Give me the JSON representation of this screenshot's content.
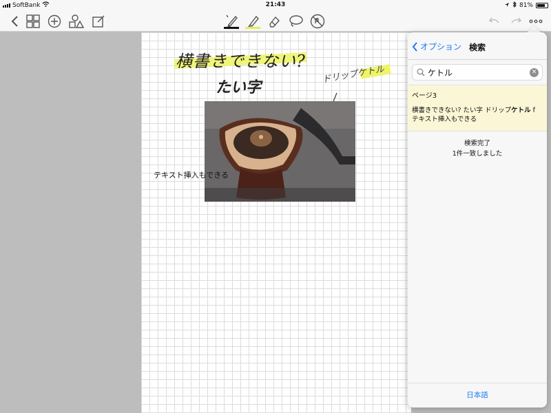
{
  "status_bar": {
    "carrier": "SoftBank",
    "time": "21:43",
    "battery": "81%",
    "battery_fraction": 0.81
  },
  "toolbar": {
    "left_icons": [
      "back-chevron-icon",
      "grid-icon",
      "add-circle-icon",
      "shapes-icon",
      "edit-icon"
    ],
    "tools": [
      {
        "name": "pen-tool",
        "underline_color": "#111111",
        "selected": true
      },
      {
        "name": "highlighter-tool",
        "underline_color": "#e8ec5a",
        "selected": false
      },
      {
        "name": "eraser-tool"
      },
      {
        "name": "lasso-tool"
      },
      {
        "name": "no-touch-tool"
      }
    ],
    "right_icons": [
      "undo-icon",
      "redo-icon",
      "more-icon"
    ]
  },
  "canvas": {
    "handwriting_title": "横書きできない?",
    "handwriting_futoi": "たい字",
    "handwriting_drip": "ドリップケトル",
    "text_insert": "テキスト挿入もできる",
    "highlight_color": "#eef46a"
  },
  "search_panel": {
    "back_label": "オプション",
    "title": "検索",
    "query": "ケトル",
    "result": {
      "page_label": "ページ3",
      "snippet_before": "横書きできない? たい字 ドリップ",
      "snippet_match": "ケトル",
      "snippet_after": " f",
      "snippet_line2": "テキスト挿入もできる"
    },
    "status_line1": "検索完了",
    "status_line2": "1件一致しました",
    "language_button": "日本語"
  },
  "accent_color": "#1a7cf2"
}
